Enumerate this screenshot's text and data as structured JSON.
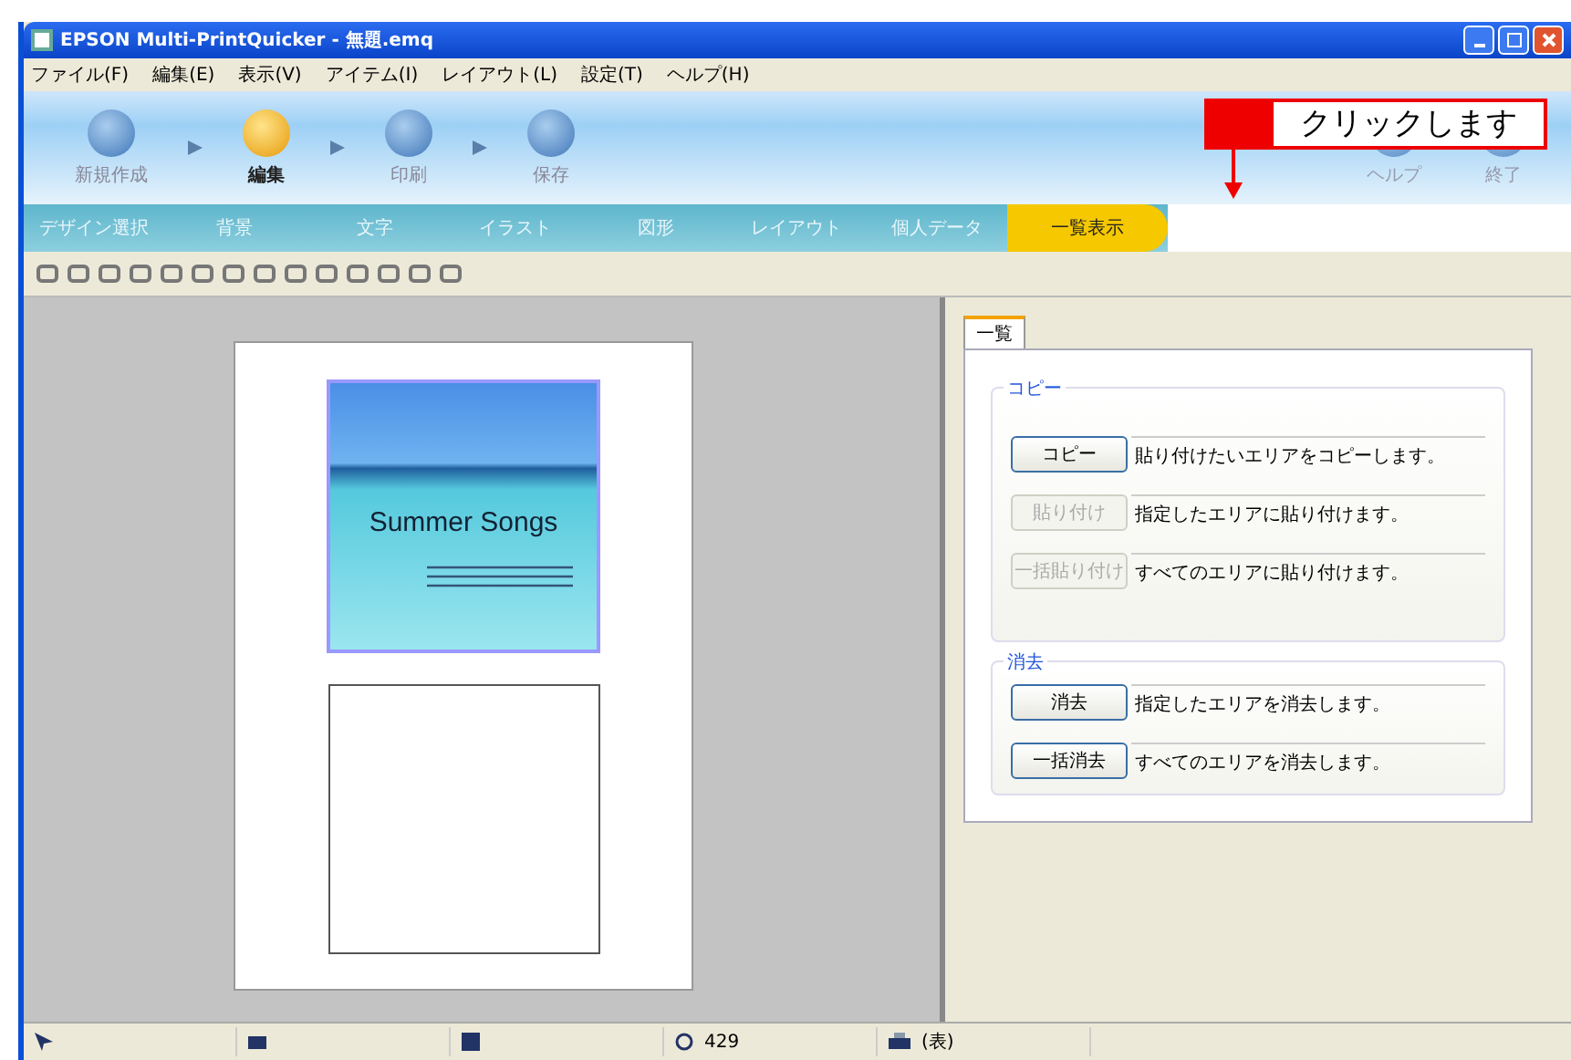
{
  "window": {
    "title": "EPSON Multi-PrintQuicker - 無題.emq"
  },
  "menu": [
    "ファイル(F)",
    "編集(E)",
    "表示(V)",
    "アイテム(I)",
    "レイアウト(L)",
    "設定(T)",
    "ヘルプ(H)"
  ],
  "steps": [
    {
      "label": "新規作成",
      "selected": false
    },
    {
      "label": "編集",
      "selected": true
    },
    {
      "label": "印刷",
      "selected": false
    },
    {
      "label": "保存",
      "selected": false
    }
  ],
  "side_buttons": [
    "ヘルプ",
    "終了"
  ],
  "callout": {
    "text": "クリックします"
  },
  "tabs": [
    {
      "label": "デザイン選択",
      "selected": false
    },
    {
      "label": "背景",
      "selected": false
    },
    {
      "label": "文字",
      "selected": false
    },
    {
      "label": "イラスト",
      "selected": false
    },
    {
      "label": "図形",
      "selected": false
    },
    {
      "label": "レイアウト",
      "selected": false
    },
    {
      "label": "個人データ",
      "selected": false
    },
    {
      "label": "一覧表示",
      "selected": true
    }
  ],
  "canvas": {
    "title_text": "Summer Songs"
  },
  "panel": {
    "tab": "一覧",
    "groups": [
      {
        "title": "コピー",
        "actions": [
          {
            "button": "コピー",
            "description": "貼り付けたいエリアをコピーします。",
            "disabled": false
          },
          {
            "button": "貼り付け",
            "description": "指定したエリアに貼り付けます。",
            "disabled": true
          },
          {
            "button": "一括貼り付け",
            "description": "すべてのエリアに貼り付けます。",
            "disabled": true
          }
        ]
      },
      {
        "title": "消去",
        "actions": [
          {
            "button": "消去",
            "description": "指定したエリアを消去します。",
            "disabled": false
          },
          {
            "button": "一括消去",
            "description": "すべてのエリアを消去します。",
            "disabled": false
          }
        ]
      }
    ]
  },
  "status_bar": [
    "429",
    "(表)"
  ]
}
